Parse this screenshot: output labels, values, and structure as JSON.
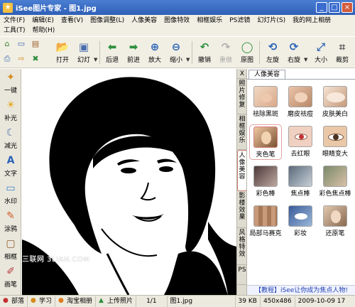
{
  "window": {
    "title": "iSee图片专家 - 图1.jpg",
    "buttons": {
      "minimize": "_",
      "maximize": "□",
      "close": "×"
    }
  },
  "menu": {
    "row1": [
      "文件(F)",
      "编辑(E)",
      "查看(V)",
      "图像调整(L)",
      "人像美容",
      "图像特效",
      "相框娱乐",
      "PS滤镜",
      "幻灯片(S)",
      "我的网上相册"
    ],
    "row2": [
      "工具(T)",
      "帮助(H)"
    ]
  },
  "toolbar": {
    "items": [
      {
        "label": "打开",
        "icon": "open-folder-icon",
        "glyph": "📂"
      },
      {
        "label": "幻灯",
        "icon": "slideshow-icon",
        "glyph": "▣"
      },
      {
        "label": "后退",
        "icon": "back-arrow-icon",
        "glyph": "⬅"
      },
      {
        "label": "前进",
        "icon": "forward-arrow-icon",
        "glyph": "➡"
      },
      {
        "label": "放大",
        "icon": "zoom-in-icon",
        "glyph": "⊕"
      },
      {
        "label": "缩小",
        "icon": "zoom-out-icon",
        "glyph": "⊖"
      },
      {
        "label": "撤销",
        "icon": "undo-icon",
        "glyph": "↶"
      },
      {
        "label": "重做",
        "icon": "redo-icon",
        "glyph": "↷",
        "disabled": true
      },
      {
        "label": "原图",
        "icon": "original-image-icon",
        "glyph": "◯"
      },
      {
        "label": "左旋",
        "icon": "rotate-left-icon",
        "glyph": "⟲"
      },
      {
        "label": "右旋",
        "icon": "rotate-right-icon",
        "glyph": "⟳"
      },
      {
        "label": "大小",
        "icon": "resize-icon",
        "glyph": "⤢"
      },
      {
        "label": "裁剪",
        "icon": "crop-icon",
        "glyph": "⌗"
      }
    ]
  },
  "left_tools": [
    {
      "label": "一键",
      "icon": "one-click-icon",
      "glyph": "✦"
    },
    {
      "label": "补光",
      "icon": "fill-light-icon",
      "glyph": "☀"
    },
    {
      "label": "减光",
      "icon": "reduce-light-icon",
      "glyph": "☾"
    },
    {
      "label": "文字",
      "icon": "text-icon",
      "glyph": "A"
    },
    {
      "label": "水印",
      "icon": "watermark-icon",
      "glyph": "▭"
    },
    {
      "label": "涂鸦",
      "icon": "doodle-icon",
      "glyph": "✎"
    },
    {
      "label": "相框",
      "icon": "photo-frame-icon",
      "glyph": "▢"
    },
    {
      "label": "画笔",
      "icon": "brush-icon",
      "glyph": "✐"
    }
  ],
  "side_tabs": [
    {
      "label": "照片修复"
    },
    {
      "label": "相框娱乐"
    },
    {
      "label": "人像美容",
      "active": true
    },
    {
      "label": "影楼效果"
    },
    {
      "label": "风格特效"
    },
    {
      "label": "PS"
    }
  ],
  "side_close": "X",
  "panel": {
    "tab_label": "人像美容",
    "items": [
      {
        "label": "祛除黑斑"
      },
      {
        "label": "磨皮祛痘"
      },
      {
        "label": "皮肤美白"
      },
      {
        "label": "夹色笔",
        "selected": true
      },
      {
        "label": "去红眼"
      },
      {
        "label": "眼睛变大"
      },
      {
        "label": "彩色棒"
      },
      {
        "label": "焦点棒"
      },
      {
        "label": "彩色焦点棒"
      },
      {
        "label": "局部马赛克"
      },
      {
        "label": "彩妆"
      },
      {
        "label": "还原笔"
      }
    ],
    "link_text": "【教程】iSee让你成为焦点人物!"
  },
  "status": {
    "items": [
      {
        "label": "部落",
        "icon": "tribe-icon"
      },
      {
        "label": "学习",
        "icon": "learn-icon"
      },
      {
        "label": "淘宝相册",
        "icon": "taobao-album-icon"
      },
      {
        "label": "上传照片",
        "icon": "upload-icon"
      }
    ],
    "page": "1/1",
    "filename": "图1.jpg",
    "filesize": "39 KB",
    "dimensions": "450x486",
    "datetime": "2009-10-09 17"
  },
  "watermark_text": "三联网 3LIAN.COM",
  "colors": {
    "title_bar": "#2f5fb8",
    "panel_link": "#1f3fb1",
    "selected_border": "#d57f7f"
  }
}
